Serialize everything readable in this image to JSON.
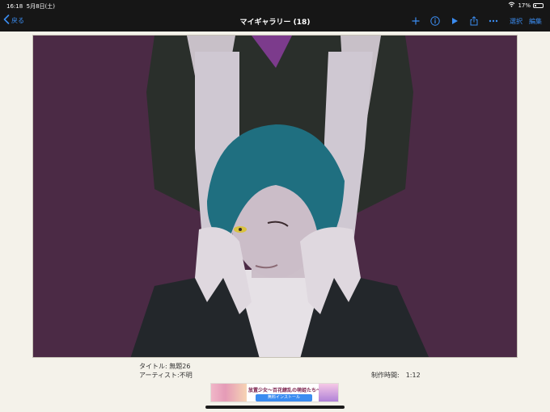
{
  "status_bar": {
    "time": "16:18",
    "date": "5月8日(土)",
    "battery": "17%",
    "battery_level": 0.17
  },
  "nav": {
    "back_label": "戻る",
    "title": "マイギャラリー (18)",
    "select_label": "選択",
    "edit_label": "編集",
    "accent_color": "#3b8cf0"
  },
  "artwork": {
    "background_color": "#4b2a45"
  },
  "details": {
    "title": "タイトル: 無題26",
    "artist": "アーティスト:不明",
    "duration": "制作時間:　1:12"
  },
  "ad": {
    "title": "放置少女～百花繚乱の萌姫たち～",
    "cta": "無料インストール"
  },
  "icons": [
    "chevron-left-icon",
    "wifi-icon",
    "battery-icon",
    "plus-icon",
    "info-icon",
    "play-icon",
    "share-icon",
    "more-icon"
  ]
}
